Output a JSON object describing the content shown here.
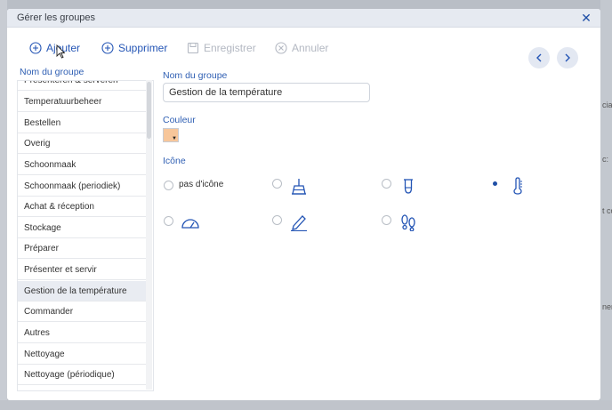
{
  "background": {
    "fragments": [
      "cial",
      "c:",
      "t co",
      "nen"
    ]
  },
  "dialog": {
    "title": "Gérer les groupes",
    "close_symbol": "✕"
  },
  "toolbar": {
    "add_label": "Ajouter",
    "delete_label": "Supprimer",
    "save_label": "Enregistrer",
    "cancel_label": "Annuler"
  },
  "list": {
    "label": "Nom du groupe",
    "items": [
      "Presenteren & serveren",
      "Temperatuurbeheer",
      "Bestellen",
      "Overig",
      "Schoonmaak",
      "Schoonmaak (periodiek)",
      "Achat & réception",
      "Stockage",
      "Préparer",
      "Présenter et servir",
      "Gestion de la température",
      "Commander",
      "Autres",
      "Nettoyage",
      "Nettoyage (périodique)"
    ],
    "selected": "Gestion de la température"
  },
  "form": {
    "name_label": "Nom du groupe",
    "name_value": "Gestion de la température",
    "color_label": "Couleur",
    "color_value": "#f7c69a",
    "icon_label": "Icône",
    "no_icon_label": "pas d'icône",
    "icon_options": [
      "none",
      "broom-icon",
      "flask-icon",
      "thermometer-icon",
      "gauge-icon",
      "pencil-icon",
      "footprints-icon"
    ],
    "selected_icon": "thermometer-icon"
  },
  "colors": {
    "accent": "#2455b5",
    "disabled": "#b3b8c2",
    "titlebar": "#e6eaf1"
  }
}
